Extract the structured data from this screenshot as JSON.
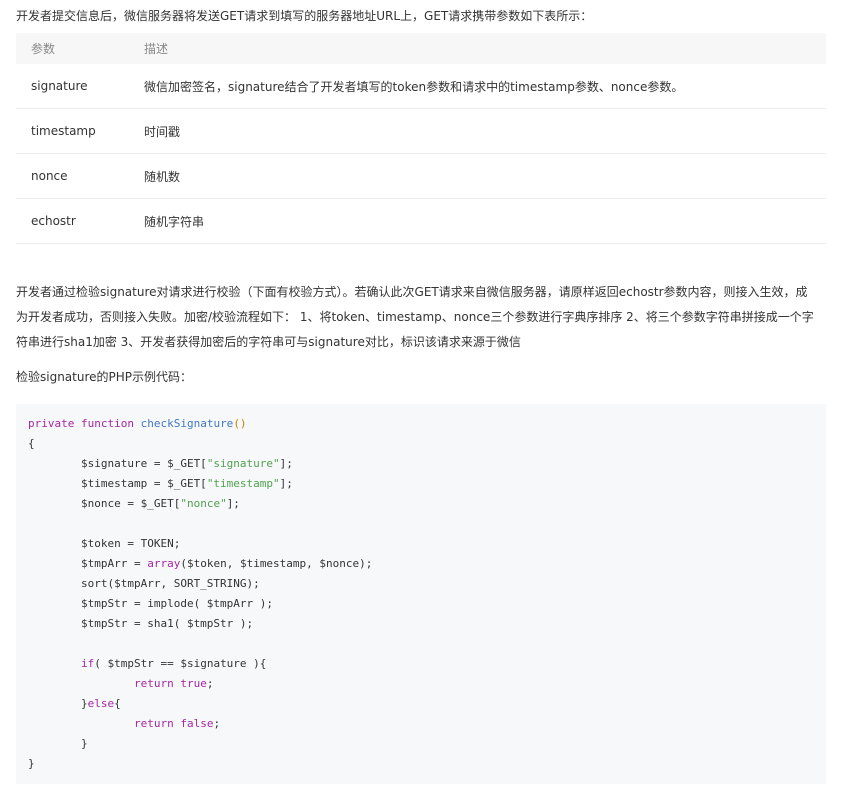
{
  "intro": "开发者提交信息后，微信服务器将发送GET请求到填写的服务器地址URL上，GET请求携带参数如下表所示：",
  "table": {
    "headers": [
      "参数",
      "描述"
    ],
    "rows": [
      [
        "signature",
        "微信加密签名，signature结合了开发者填写的token参数和请求中的timestamp参数、nonce参数。"
      ],
      [
        "timestamp",
        "时间戳"
      ],
      [
        "nonce",
        "随机数"
      ],
      [
        "echostr",
        "随机字符串"
      ]
    ]
  },
  "paragraph1": {
    "lines": [
      "开发者通过检验signature对请求进行校验（下面有校验方式）。若确认此次GET请求来自微信服务器，请原样返回echostr参数内容，则接入生效，成",
      "为开发者成功，否则接入失败。加密/校验流程如下： 1、将token、timestamp、nonce三个参数进行字典序排序 2、将三个参数字符串拼接成一个字",
      "符串进行sha1加密 3、开发者获得加密后的字符串可与signature对比，标识该请求来源于微信"
    ]
  },
  "paragraph2": "检验signature的PHP示例代码：",
  "code": {
    "lines": [
      [
        {
          "t": "kw",
          "v": "private"
        },
        {
          "t": "p",
          "v": " "
        },
        {
          "t": "kw",
          "v": "function"
        },
        {
          "t": "p",
          "v": " "
        },
        {
          "t": "fn",
          "v": "checkSignature"
        },
        {
          "t": "par",
          "v": "()"
        }
      ],
      [
        {
          "t": "p",
          "v": "{"
        }
      ],
      [
        {
          "t": "p",
          "v": "        $signature = $_GET["
        },
        {
          "t": "str",
          "v": "\"signature\""
        },
        {
          "t": "p",
          "v": "];"
        }
      ],
      [
        {
          "t": "p",
          "v": "        $timestamp = $_GET["
        },
        {
          "t": "str",
          "v": "\"timestamp\""
        },
        {
          "t": "p",
          "v": "];"
        }
      ],
      [
        {
          "t": "p",
          "v": "        $nonce = $_GET["
        },
        {
          "t": "str",
          "v": "\"nonce\""
        },
        {
          "t": "p",
          "v": "];"
        }
      ],
      [
        {
          "t": "p",
          "v": ""
        }
      ],
      [
        {
          "t": "p",
          "v": "        $token = TOKEN;"
        }
      ],
      [
        {
          "t": "p",
          "v": "        $tmpArr = "
        },
        {
          "t": "kw",
          "v": "array"
        },
        {
          "t": "p",
          "v": "($token, $timestamp, $nonce);"
        }
      ],
      [
        {
          "t": "p",
          "v": "        sort($tmpArr, SORT_STRING);"
        }
      ],
      [
        {
          "t": "p",
          "v": "        $tmpStr = implode( $tmpArr );"
        }
      ],
      [
        {
          "t": "p",
          "v": "        $tmpStr = sha1( $tmpStr );"
        }
      ],
      [
        {
          "t": "p",
          "v": ""
        }
      ],
      [
        {
          "t": "p",
          "v": "        "
        },
        {
          "t": "kw",
          "v": "if"
        },
        {
          "t": "p",
          "v": "( $tmpStr == $signature ){"
        }
      ],
      [
        {
          "t": "p",
          "v": "                "
        },
        {
          "t": "kw",
          "v": "return"
        },
        {
          "t": "p",
          "v": " "
        },
        {
          "t": "kw",
          "v": "true"
        },
        {
          "t": "p",
          "v": ";"
        }
      ],
      [
        {
          "t": "p",
          "v": "        }"
        },
        {
          "t": "kw",
          "v": "else"
        },
        {
          "t": "p",
          "v": "{"
        }
      ],
      [
        {
          "t": "p",
          "v": "                "
        },
        {
          "t": "kw",
          "v": "return"
        },
        {
          "t": "p",
          "v": " "
        },
        {
          "t": "kw",
          "v": "false"
        },
        {
          "t": "p",
          "v": ";"
        }
      ],
      [
        {
          "t": "p",
          "v": "        }"
        }
      ],
      [
        {
          "t": "p",
          "v": "}"
        }
      ]
    ]
  }
}
